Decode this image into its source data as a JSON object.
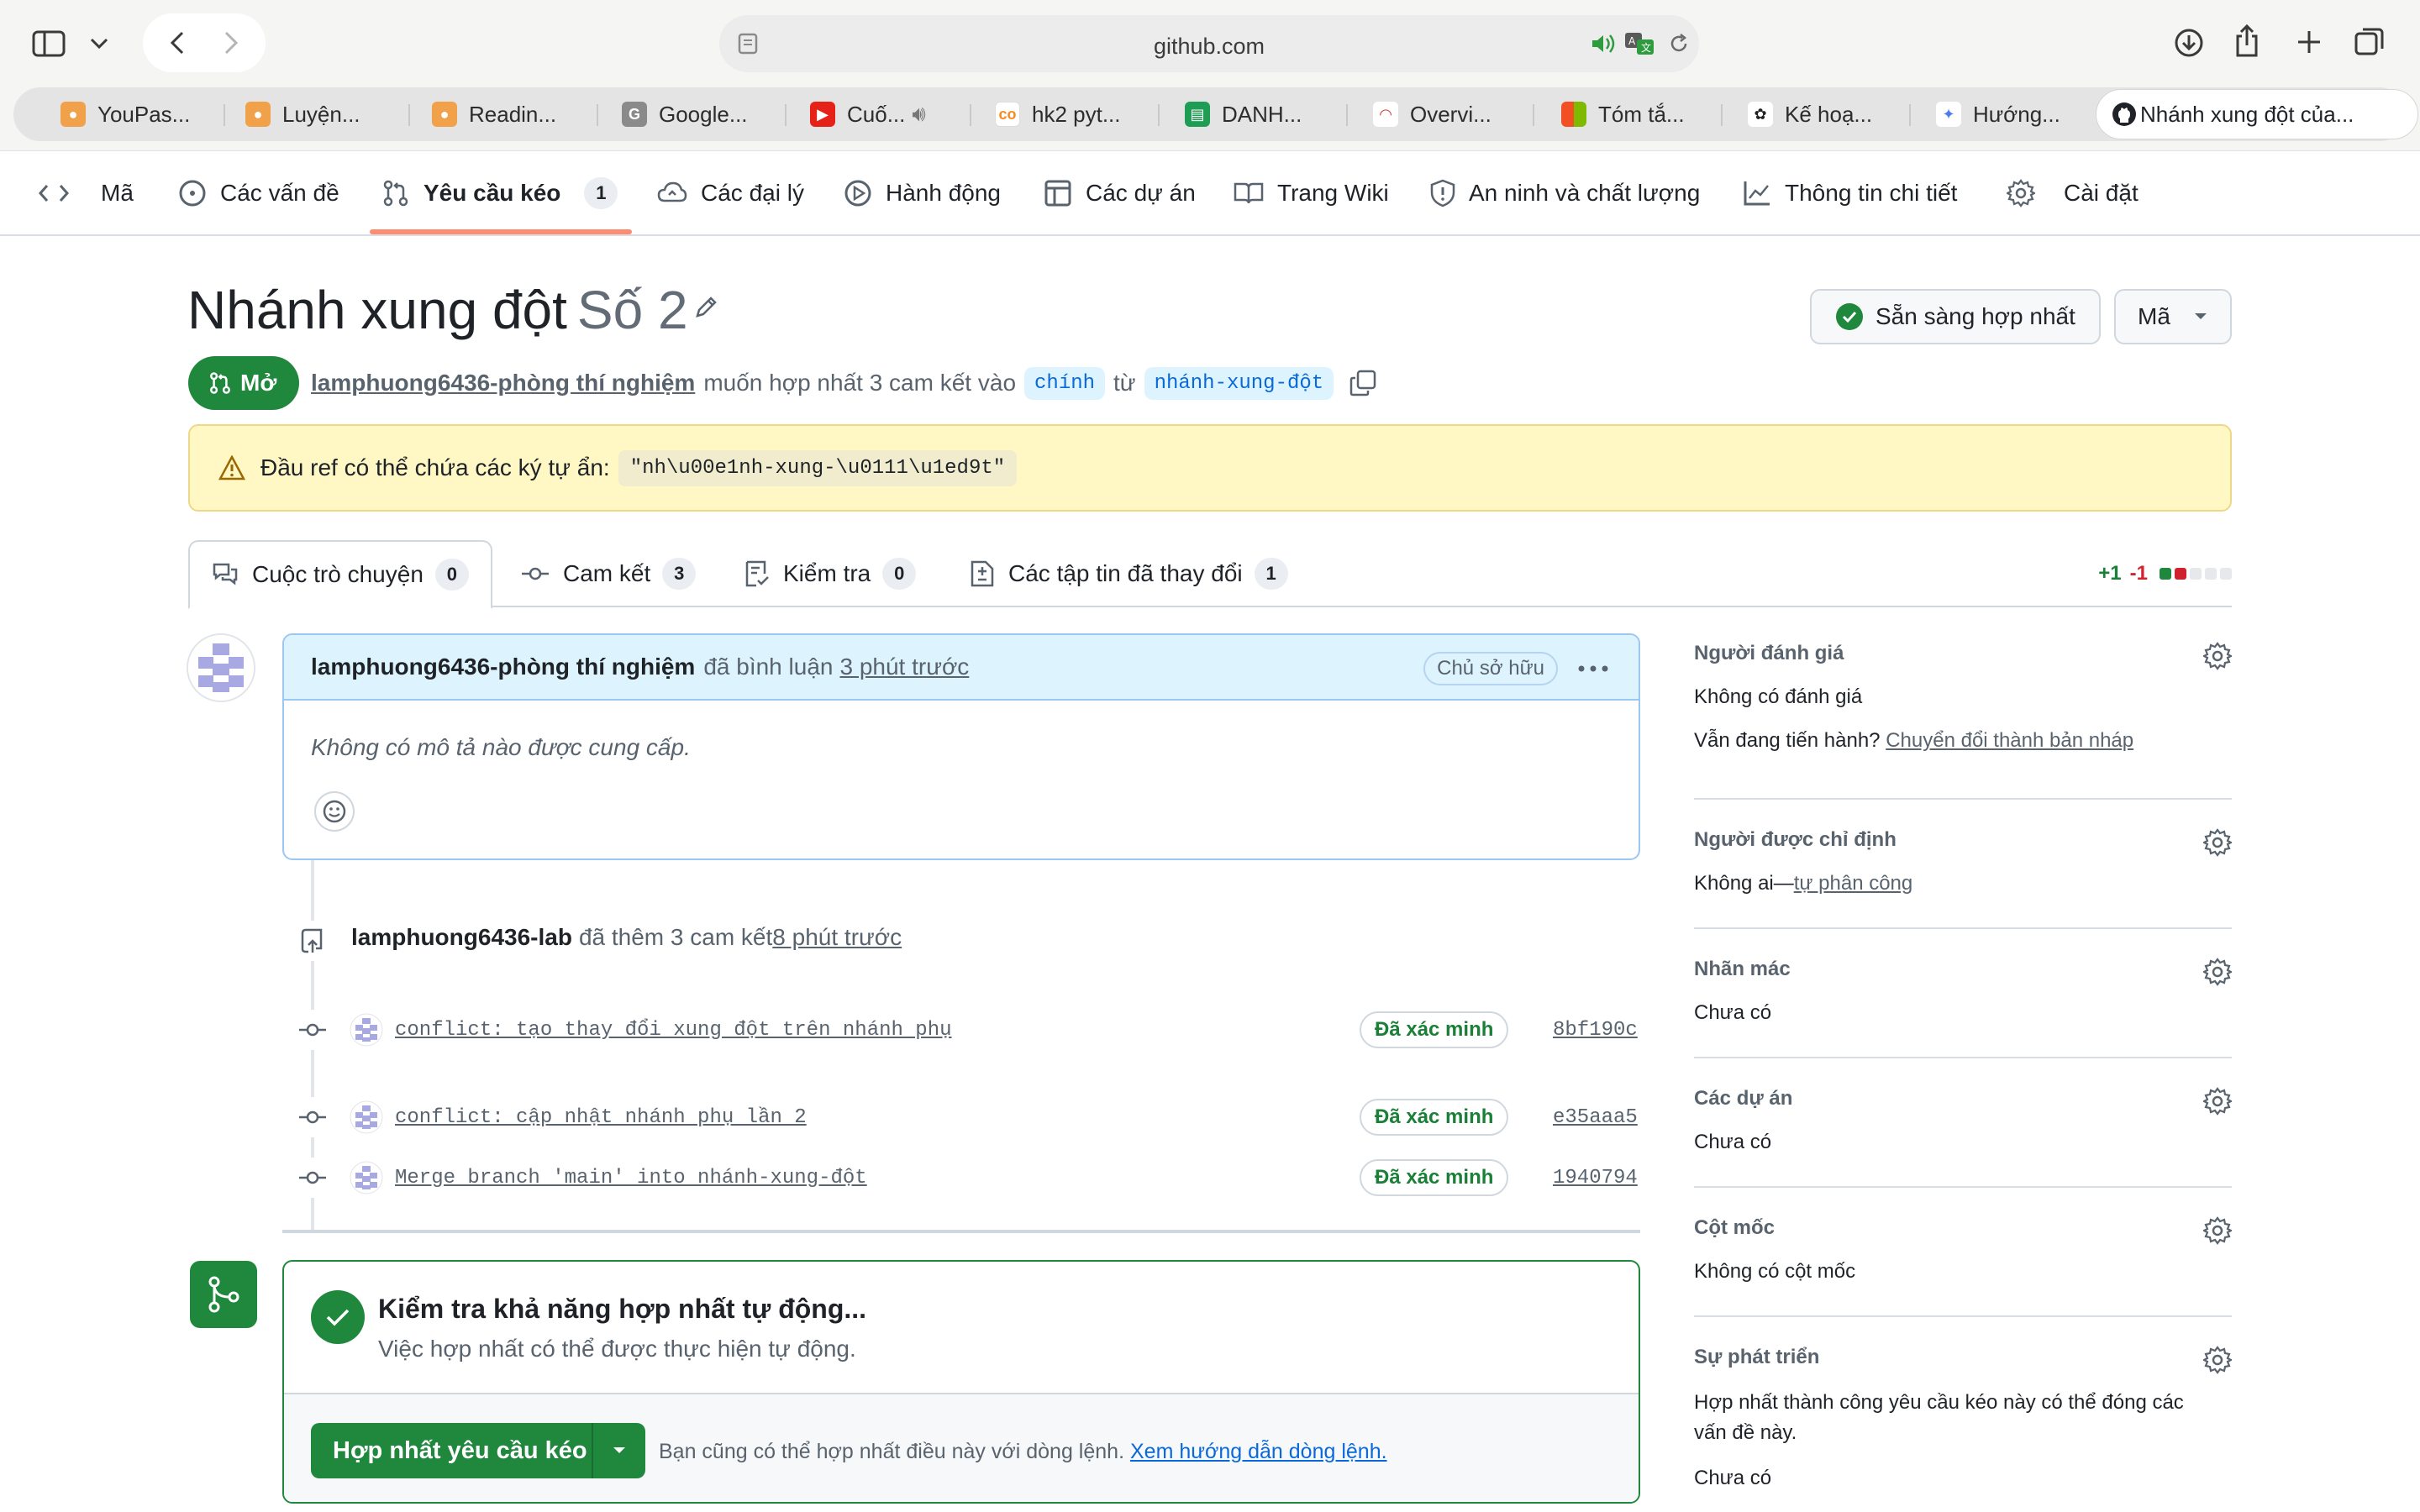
{
  "browser": {
    "url": "github.com",
    "tabs": [
      {
        "label": "YouPas...",
        "icon": "youpass-icon"
      },
      {
        "label": "Luyện...",
        "icon": "youpass-icon"
      },
      {
        "label": "Readin...",
        "icon": "youpass-icon"
      },
      {
        "label": "Google...",
        "icon": "google-icon"
      },
      {
        "label": "Cuố...",
        "icon": "youtube-icon"
      },
      {
        "label": "hk2 pyt...",
        "icon": "coursera-icon"
      },
      {
        "label": "DANH...",
        "icon": "sheets-icon"
      },
      {
        "label": "Overvi...",
        "icon": "dashboard-icon"
      },
      {
        "label": "Tóm tắ...",
        "icon": "microsoft-icon"
      },
      {
        "label": "Kế hoạ...",
        "icon": "openai-icon"
      },
      {
        "label": "Hướng...",
        "icon": "gemini-icon"
      }
    ],
    "active_tab": "Nhánh xung đột của..."
  },
  "repo_nav": {
    "code": "Mã",
    "issues": "Các vấn đề",
    "pull_requests": "Yêu cầu kéo",
    "pull_requests_count": "1",
    "agents": "Các đại lý",
    "actions": "Hành động",
    "projects": "Các dự án",
    "wiki": "Trang Wiki",
    "security": "An ninh và chất lượng",
    "insights": "Thông tin chi tiết",
    "settings": "Cài đặt"
  },
  "pr": {
    "title": "Nhánh xung đột",
    "number": "Số 2",
    "ready_button": "Sẵn sàng hợp nhất",
    "code_button": "Mã",
    "state": "Mở",
    "author": "lamphuong6436-phòng thí nghiệm",
    "meta_text": "muốn hợp nhất 3 cam kết vào",
    "base_branch": "chính",
    "from_text": "từ",
    "head_branch": "nhánh-xung-đột",
    "warning_text": "Đầu ref có thể chứa các ký tự ẩn:",
    "warning_code": "\"nh\\u00e1nh-xung-\\u0111\\u1ed9t\""
  },
  "pr_tabs": {
    "conversation": "Cuộc trò chuyện",
    "conversation_count": "0",
    "commits": "Cam kết",
    "commits_count": "3",
    "checks": "Kiểm tra",
    "checks_count": "0",
    "files": "Các tập tin đã thay đổi",
    "files_count": "1",
    "additions": "+1",
    "deletions": "-1"
  },
  "comment": {
    "author": "lamphuong6436-phòng thí nghiệm",
    "action": "đã bình luận",
    "time": "3 phút trước",
    "badge": "Chủ sở hữu",
    "body": "Không có mô tả nào được cung cấp."
  },
  "commits_event": {
    "author": "lamphuong6436-lab",
    "action": "đã thêm 3 cam kết",
    "time": "8 phút trước"
  },
  "commits": [
    {
      "message": "conflict: tạo thay đổi xung đột trên nhánh phụ",
      "badge": "Đã xác minh",
      "sha": "8bf190c"
    },
    {
      "message": "conflict: cập nhật nhánh phụ lần 2",
      "badge": "Đã xác minh",
      "sha": "e35aaa5"
    },
    {
      "message": "Merge branch 'main' into nhánh-xung-đột",
      "badge": "Đã xác minh",
      "sha": "1940794"
    }
  ],
  "merge": {
    "title": "Kiểm tra khả năng hợp nhất tự động...",
    "subtitle": "Việc hợp nhất có thể được thực hiện tự động.",
    "button": "Hợp nhất yêu cầu kéo",
    "hint": "Bạn cũng có thể hợp nhất điều này với dòng lệnh.",
    "hint_link": "Xem hướng dẫn dòng lệnh."
  },
  "sidebar": {
    "reviewers_title": "Người đánh giá",
    "reviewers_value": "Không có đánh giá",
    "draft_prefix": "Vẫn đang tiến hành?",
    "draft_link": "Chuyển đổi thành bản nháp",
    "assignees_title": "Người được chỉ định",
    "assignees_value": "Không ai—",
    "assignees_link": "tự phân công",
    "labels_title": "Nhãn mác",
    "labels_value": "Chưa có",
    "projects_title": "Các dự án",
    "projects_value": "Chưa có",
    "milestone_title": "Cột mốc",
    "milestone_value": "Không có cột mốc",
    "development_title": "Sự phát triển",
    "development_line1": "Hợp nhất thành công yêu cầu kéo này có thể đóng các",
    "development_line2": "vấn đề này.",
    "development_value": "Chưa có"
  },
  "colors": {
    "accent_green": "#1f883d",
    "nav_underline": "#fd8c73",
    "link_blue": "#0969da",
    "warning_bg": "#fff8c5"
  }
}
